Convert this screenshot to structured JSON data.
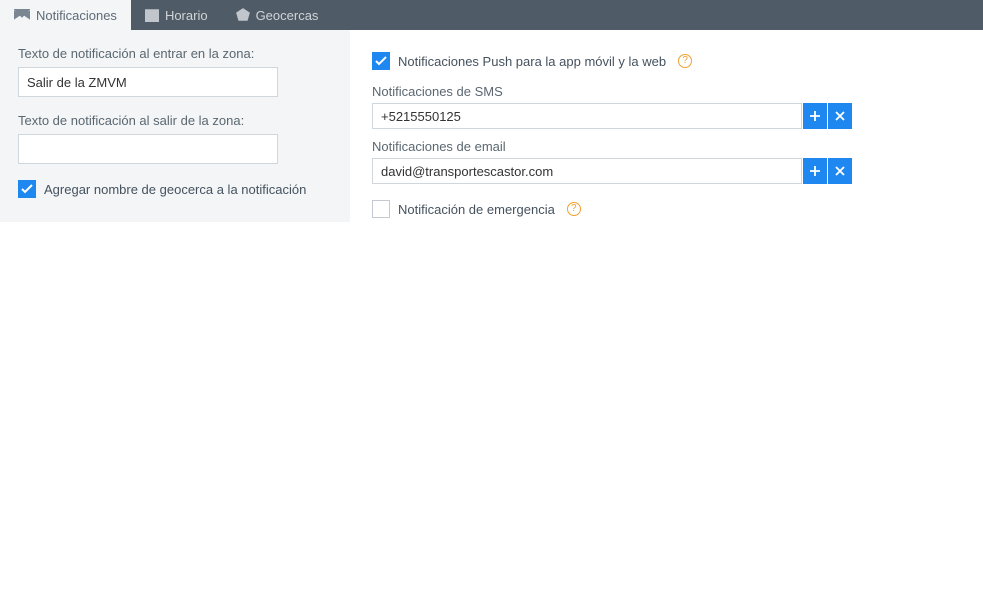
{
  "tabs": {
    "notifications": "Notificaciones",
    "schedule": "Horario",
    "geofences": "Geocercas"
  },
  "left": {
    "enter_label": "Texto de notificación al entrar en la zona:",
    "enter_value": "Salir de la ZMVM",
    "exit_label": "Texto de notificación al salir de la zona:",
    "exit_value": "",
    "append_geofence_label": "Agregar nombre de geocerca a la notificación"
  },
  "right": {
    "push_label": "Notificaciones Push para la app móvil y la web",
    "sms_label": "Notificaciones de SMS",
    "sms_value": "+5215550125",
    "email_label": "Notificaciones de email",
    "email_value": "david@transportescastor.com",
    "emergency_label": "Notificación de emergencia"
  },
  "help_glyph": "?"
}
